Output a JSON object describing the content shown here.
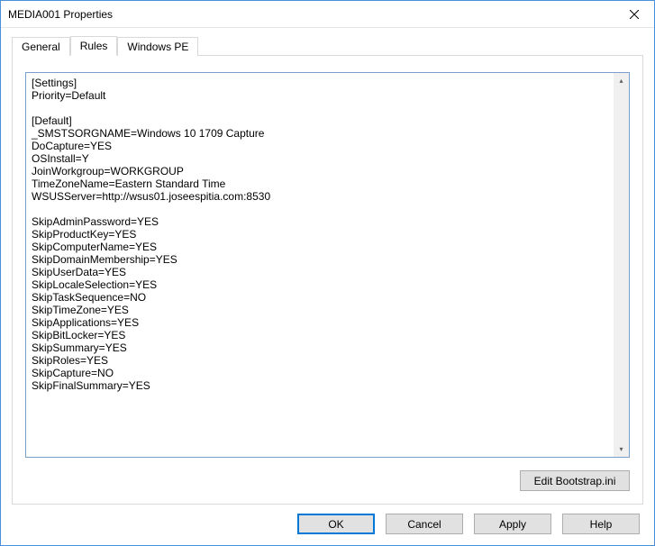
{
  "window": {
    "title": "MEDIA001 Properties",
    "close_icon": "close"
  },
  "tabs": {
    "general": "General",
    "rules": "Rules",
    "windowspe": "Windows PE"
  },
  "rules_text": "[Settings]\nPriority=Default\n\n[Default]\n_SMSTSORGNAME=Windows 10 1709 Capture\nDoCapture=YES\nOSInstall=Y\nJoinWorkgroup=WORKGROUP\nTimeZoneName=Eastern Standard Time\nWSUSServer=http://wsus01.joseespitia.com:8530\n\nSkipAdminPassword=YES\nSkipProductKey=YES\nSkipComputerName=YES\nSkipDomainMembership=YES\nSkipUserData=YES\nSkipLocaleSelection=YES\nSkipTaskSequence=NO\nSkipTimeZone=YES\nSkipApplications=YES\nSkipBitLocker=YES\nSkipSummary=YES\nSkipRoles=YES\nSkipCapture=NO\nSkipFinalSummary=YES",
  "buttons": {
    "edit_bootstrap": "Edit Bootstrap.ini",
    "ok": "OK",
    "cancel": "Cancel",
    "apply": "Apply",
    "help": "Help"
  }
}
